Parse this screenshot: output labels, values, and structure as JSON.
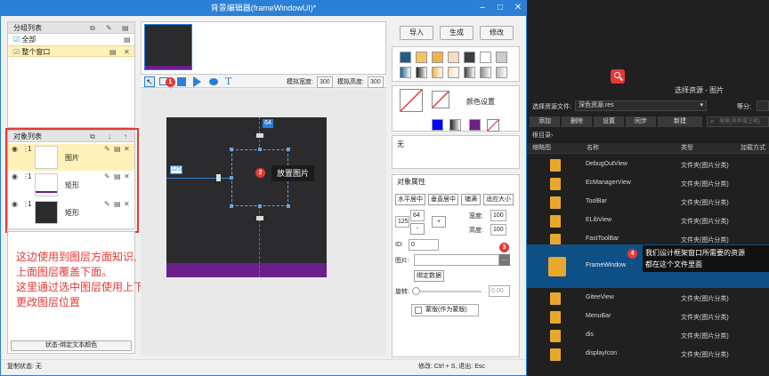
{
  "window": {
    "title": "背景编辑器(frameWindowUI)*",
    "min": "–",
    "max": "□",
    "close": "✕"
  },
  "group_panel": {
    "title": "分组列表",
    "items": [
      {
        "label": "全部"
      },
      {
        "label": "整个窗口"
      }
    ]
  },
  "object_panel": {
    "title": "对象列表",
    "layers": [
      {
        "num": "1",
        "label": "图片"
      },
      {
        "num": "1",
        "label": "矩形"
      },
      {
        "num": "1",
        "label": "矩形"
      }
    ],
    "status_button": "状态-绑定文本颜色"
  },
  "toolbar": {
    "sim_width_label": "模拟宽度:",
    "sim_width": "300",
    "sim_height_label": "模拟高度:",
    "sim_height": "300"
  },
  "canvas": {
    "offset_top": "64",
    "offset_left": "125",
    "placed_image_label": "放置图片"
  },
  "right_panel": {
    "btn_import": "导入",
    "btn_generate": "生成",
    "btn_modify": "修改",
    "color_settings": "颜色设置",
    "none_text": "无",
    "obj_props": "对象属性",
    "btn_hcenter": "水平居中",
    "btn_vcenter": "垂直居中",
    "btn_fill": "铺满",
    "btn_fit": "适应大小",
    "x": "125",
    "y": "64",
    "width_label": "宽度:",
    "width": "100",
    "height_label": "高度:",
    "height": "100",
    "id_label": "ID:",
    "id": "0",
    "image_label": "图片:",
    "btn_bind_data": "绑定数据",
    "rotate_label": "旋转:",
    "rotate": "0.00",
    "mask_label": "蒙版(作为蒙版)"
  },
  "statusbar": {
    "copy_status": "复制状态:  无",
    "hint": "修改: Ctrl + S, 退出: Esc"
  },
  "annotation": {
    "lines": [
      "这边使用到图层方面知识,",
      "上面图层覆盖下面。",
      "这里通过选中图层使用上下箭头可以",
      "更改图层位置"
    ],
    "badges": [
      "1",
      "2",
      "3",
      "4"
    ]
  },
  "resource_panel": {
    "title": "选择资源 - 图片",
    "file_label": "选择资源文件:",
    "file_value": "深色资源.res",
    "ratio_label": "等分:",
    "btn_add": "添加",
    "btn_delete": "删除",
    "btn_settings": "设置",
    "btn_sync": "同步",
    "btn_new": "新建",
    "search_placeholder": "搜索(名称或注释)",
    "breadcrumb": "根目录›",
    "col_thumb": "缩略图",
    "col_name": "名称",
    "col_type": "类型",
    "col_load": "加载方式",
    "rows": [
      {
        "name": "DebugOutView",
        "type": "文件夹(图片分类)"
      },
      {
        "name": "EcManagerView",
        "type": "文件夹(图片分类)"
      },
      {
        "name": "ToolBar",
        "type": "文件夹(图片分类)"
      },
      {
        "name": "ELibView",
        "type": "文件夹(图片分类)"
      },
      {
        "name": "FastToolBar",
        "type": "文件夹(图片分类)"
      },
      {
        "name": "FrameWindow",
        "type": ""
      },
      {
        "name": "GiteeView",
        "type": "文件夹(图片分类)"
      },
      {
        "name": "MenuBar",
        "type": "文件夹(图片分类)"
      },
      {
        "name": "dis",
        "type": "文件夹(图片分类)"
      },
      {
        "name": "displayIcon",
        "type": "文件夹(图片分类)"
      }
    ],
    "tooltip_line1": "我们设计框架窗口所需要的资源",
    "tooltip_line2": "都在这个文件里面"
  },
  "colors": {
    "accent": "#2b7fd4",
    "annotation_red": "#e53935",
    "canvas_dark": "#2b2b2e",
    "canvas_purple": "#6a1f8a",
    "selected_row": "#fff1b8",
    "resource_bg": "#202020",
    "resource_selected": "#0e4f86"
  }
}
